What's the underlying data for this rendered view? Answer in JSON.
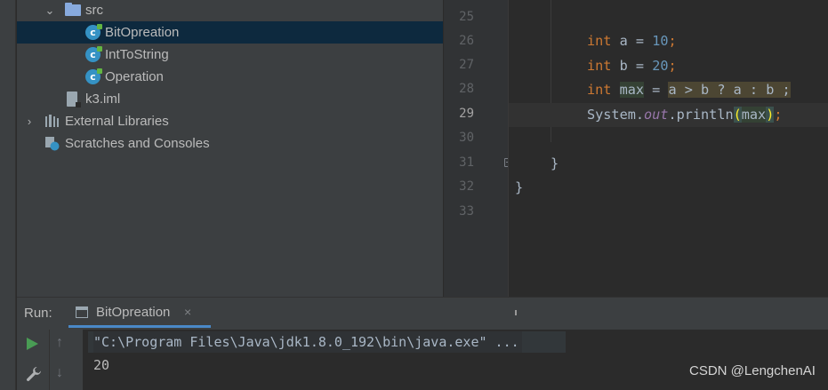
{
  "project_tree": {
    "items": [
      {
        "label": "src",
        "type": "folder",
        "icon": "folder-icon"
      },
      {
        "label": "BitOpreation",
        "type": "class",
        "icon": "java-class-icon",
        "selected": true
      },
      {
        "label": "IntToString",
        "type": "class",
        "icon": "java-class-icon"
      },
      {
        "label": "Operation",
        "type": "class",
        "icon": "java-class-icon"
      },
      {
        "label": "k3.iml",
        "type": "file",
        "icon": "module-file-icon"
      },
      {
        "label": "External Libraries",
        "type": "library",
        "icon": "library-icon"
      },
      {
        "label": "Scratches and Consoles",
        "type": "scratches",
        "icon": "scratches-icon"
      }
    ]
  },
  "editor": {
    "line_numbers": [
      "25",
      "26",
      "27",
      "28",
      "29",
      "30",
      "31",
      "32",
      "33"
    ],
    "current_line": "29",
    "code": {
      "l26_kw": "int",
      "l26_var": "a",
      "l26_op": " = ",
      "l26_num": "10",
      "l26_end": ";",
      "l27_kw": "int",
      "l27_var": "b",
      "l27_op": " = ",
      "l27_num": "20",
      "l27_end": ";",
      "l28_kw": "int",
      "l28_var": "max",
      "l28_op": " = ",
      "l28_expr": "a > b ? a : b ;",
      "l29_sys": "System.",
      "l29_out": "out",
      "l29_call": ".println",
      "l29_open": "(",
      "l29_arg": "max",
      "l29_close": ")",
      "l29_end": ";",
      "l31": "}",
      "l32": "}"
    }
  },
  "run_panel": {
    "title": "Run:",
    "tab_label": "BitOpreation",
    "tab_close": "×",
    "console_command": "\"C:\\Program Files\\Java\\jdk1.8.0_192\\bin\\java.exe\" ...",
    "console_output": "20",
    "icons": [
      "play-icon",
      "wrench-icon",
      "arrow-up-icon",
      "arrow-down-icon"
    ]
  },
  "watermark": "CSDN @LengchenAI",
  "colors": {
    "keyword": "#cc7832",
    "number": "#6897bb",
    "static_field": "#9876aa",
    "selection": "#0d293e",
    "run_green": "#499c54"
  }
}
